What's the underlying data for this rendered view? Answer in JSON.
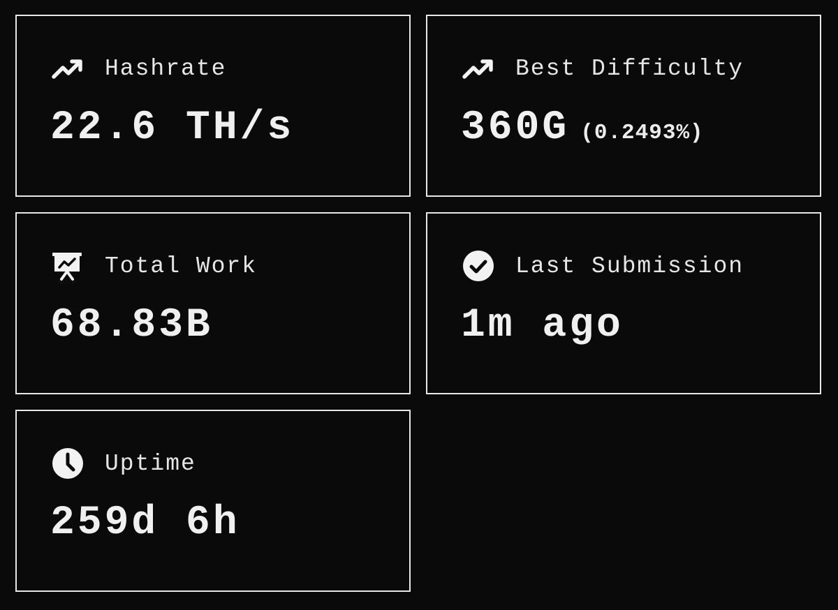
{
  "cards": [
    {
      "label": "Hashrate",
      "icon": "trending-up-icon",
      "value": "22.6 TH/s",
      "sub": ""
    },
    {
      "label": "Best Difficulty",
      "icon": "trending-up-icon",
      "value": "360G",
      "sub": "(0.2493%)"
    },
    {
      "label": "Total Work",
      "icon": "presentation-chart-icon",
      "value": "68.83B",
      "sub": ""
    },
    {
      "label": "Last Submission",
      "icon": "check-circle-icon",
      "value": "1m ago",
      "sub": ""
    },
    {
      "label": "Uptime",
      "icon": "clock-icon",
      "value": "259d 6h",
      "sub": ""
    }
  ],
  "colors": {
    "background": "#0a0a0a",
    "border": "#e8e8e8",
    "text": "#f0f0f0"
  }
}
